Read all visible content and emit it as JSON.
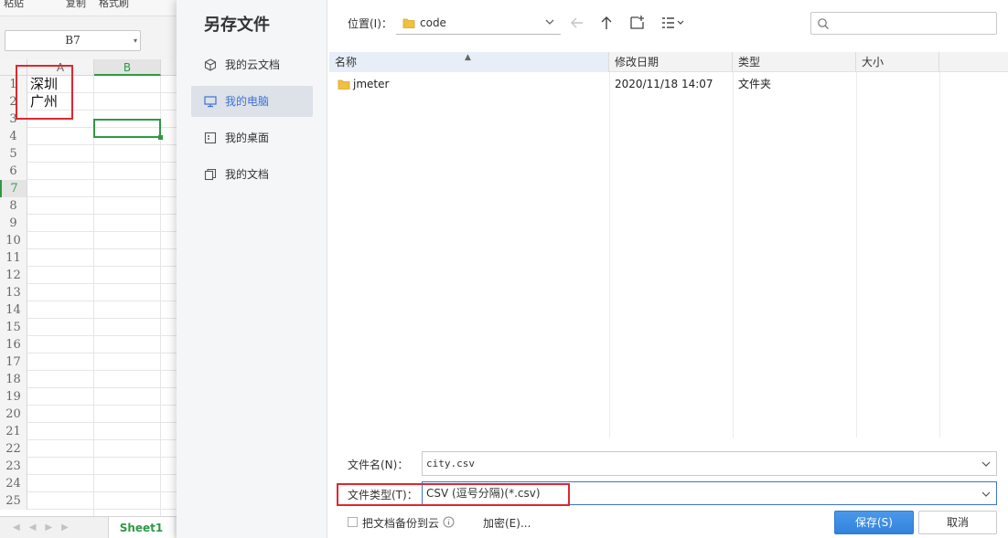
{
  "spreadsheet": {
    "toolbar_fragments": [
      "粘贴",
      "复制",
      "格式刷"
    ],
    "name_box": "B7",
    "columns": [
      "A",
      "B"
    ],
    "rows": [
      "1",
      "2",
      "3",
      "4",
      "5",
      "6",
      "7",
      "8",
      "9",
      "10",
      "11",
      "12",
      "13",
      "14",
      "15",
      "16",
      "17",
      "18",
      "19",
      "20",
      "21",
      "22",
      "23",
      "24",
      "25"
    ],
    "cells": {
      "A1": "深圳",
      "A2": "广州"
    },
    "selected_column": "B",
    "selected_row": "7",
    "sheet_tab": "Sheet1"
  },
  "dialog": {
    "title": "另存文件",
    "nav": [
      {
        "label": "我的云文档",
        "icon": "cloud-doc-icon"
      },
      {
        "label": "我的电脑",
        "icon": "computer-icon",
        "active": true
      },
      {
        "label": "我的桌面",
        "icon": "desktop-icon"
      },
      {
        "label": "我的文档",
        "icon": "documents-icon"
      }
    ],
    "location_label": "位置(I)：",
    "location_value": "code",
    "columns": {
      "name": "名称",
      "date": "修改日期",
      "type": "类型",
      "size": "大小"
    },
    "files": [
      {
        "name": "jmeter",
        "date": "2020/11/18 14:07",
        "type": "文件夹",
        "size": ""
      }
    ],
    "filename_label": "文件名(N)：",
    "filename_value": "city.csv",
    "filetype_label": "文件类型(T)：",
    "filetype_value": "CSV (逗号分隔)(*.csv)",
    "backup_label": "把文档备份到云",
    "encrypt_label": "加密(E)...",
    "save_label": "保存(S)",
    "cancel_label": "取消"
  },
  "colors": {
    "accent": "#3d72d5",
    "excel_green": "#2e9945",
    "highlight_red": "#e0272d",
    "save_button": "#3a8ee6"
  }
}
